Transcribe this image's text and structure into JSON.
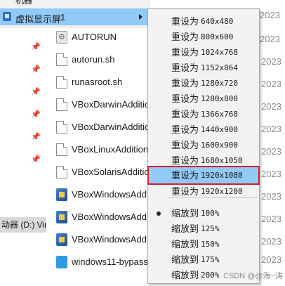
{
  "parent_menu": {
    "previous_item_fragment": "机器",
    "active_item": {
      "label": "虚拟显示屏",
      "shortcut": "1"
    }
  },
  "submenu": {
    "items": [
      {
        "label": "重设为",
        "value": "640x480"
      },
      {
        "label": "重设为",
        "value": "800x600"
      },
      {
        "label": "重设为",
        "value": "1024x768"
      },
      {
        "label": "重设为",
        "value": "1152x864"
      },
      {
        "label": "重设为",
        "value": "1280x720"
      },
      {
        "label": "重设为",
        "value": "1280x800"
      },
      {
        "label": "重设为",
        "value": "1366x768"
      },
      {
        "label": "重设为",
        "value": "1440x900"
      },
      {
        "label": "重设为",
        "value": "1600x900"
      },
      {
        "label": "重设为",
        "value": "1680x1050"
      },
      {
        "label": "重设为",
        "value": "1920x1080"
      },
      {
        "label": "重设为",
        "value": "1920x1200"
      }
    ],
    "scale_items": [
      {
        "label": "缩放到",
        "value": "100%",
        "checked": true
      },
      {
        "label": "缩放到",
        "value": "125%",
        "checked": false
      },
      {
        "label": "缩放到",
        "value": "150%",
        "checked": false
      },
      {
        "label": "缩放到",
        "value": "175%",
        "checked": false
      },
      {
        "label": "缩放到",
        "value": "200%",
        "checked": false
      }
    ]
  },
  "explorer": {
    "drive_label": "动器 (D:) Vir",
    "files": [
      {
        "name": "AUTORUN",
        "icon": "gear-icon",
        "date": ""
      },
      {
        "name": "autorun.sh",
        "icon": "document-icon",
        "date": "2023"
      },
      {
        "name": "runasroot.sh",
        "icon": "document-icon",
        "date": "2023"
      },
      {
        "name": "VBoxDarwinAdditio",
        "icon": "document-icon",
        "date": "2023"
      },
      {
        "name": "VBoxDarwinAdditio",
        "icon": "document-icon",
        "date": "2023"
      },
      {
        "name": "VBoxLinuxAddition",
        "icon": "document-icon",
        "date": "2023"
      },
      {
        "name": "VBoxSolarisAdditio",
        "icon": "document-icon",
        "date": "2023"
      },
      {
        "name": "VBoxWindowsAdd",
        "icon": "virtualbox-icon",
        "date": "2023"
      },
      {
        "name": "VBoxWindowsAdd",
        "icon": "virtualbox-icon",
        "date": "2023"
      },
      {
        "name": "VBoxWindowsAdd",
        "icon": "virtualbox-icon",
        "date": "2023"
      },
      {
        "name": "windows11-bypass",
        "icon": "registry-file-icon",
        "date": "2023"
      }
    ],
    "top_dates": [
      "2023",
      "2023"
    ]
  },
  "watermark": "CSDN @@海~涛",
  "colors": {
    "highlight": "#91c9f7",
    "selection_box": "#d0202a",
    "menu_background": "#f2f2f2"
  }
}
